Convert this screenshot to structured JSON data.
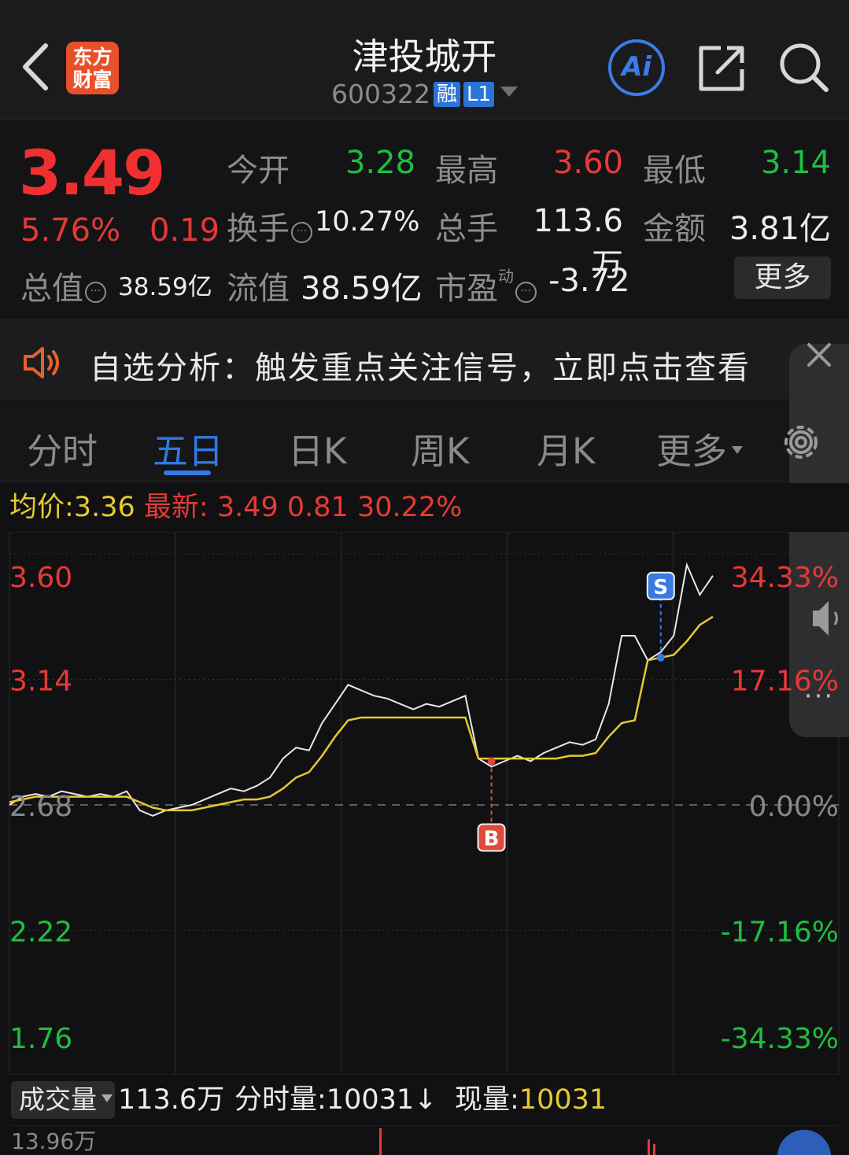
{
  "header": {
    "title": "津投城开",
    "code": "600322",
    "tag_margin": "融",
    "tag_level": "L1",
    "logo_line1": "东方",
    "logo_line2": "财富",
    "ai_label": "Ai"
  },
  "quote": {
    "price": "3.49",
    "change_pct": "5.76%",
    "change": "0.19",
    "open_label": "今开",
    "open": "3.28",
    "high_label": "最高",
    "high": "3.60",
    "low_label": "最低",
    "low": "3.14",
    "turnover_label": "换手",
    "turnover": "10.27%",
    "volume_label": "总手",
    "volume": "113.6万",
    "amount_label": "金额",
    "amount": "3.81亿",
    "mktcap_label": "总值",
    "mktcap": "38.59亿",
    "float_label": "流值",
    "float_cap": "38.59亿",
    "pe_label": "市盈",
    "pe_sup": "动",
    "pe": "-3.72",
    "more_label": "更多"
  },
  "banner": {
    "text": "自选分析：触发重点关注信号，立即点击查看"
  },
  "tabs": [
    {
      "label": "分时"
    },
    {
      "label": "五日"
    },
    {
      "label": "日K"
    },
    {
      "label": "周K"
    },
    {
      "label": "月K"
    },
    {
      "label": "更多"
    }
  ],
  "avg_row": {
    "avg_label": "均价:",
    "avg": "3.36",
    "latest_label": "最新:",
    "latest": "3.49",
    "change": "0.81",
    "change_pct": "30.22%"
  },
  "chart_data": {
    "type": "line",
    "y_labels_left": [
      "3.60",
      "3.14",
      "2.68",
      "2.22",
      "1.76"
    ],
    "y_labels_right": [
      "34.33%",
      "17.16%",
      "0.00%",
      "-17.16%",
      "-34.33%"
    ],
    "ylim": [
      1.76,
      3.6
    ],
    "baseline": 2.68,
    "days": 5,
    "series": [
      {
        "values": [
          2.68,
          2.71,
          2.72,
          2.71,
          2.73,
          2.72,
          2.71,
          2.72,
          2.71,
          2.73,
          2.66,
          2.64,
          2.66,
          2.67,
          2.68,
          2.7,
          2.72,
          2.74,
          2.73,
          2.75,
          2.78,
          2.85,
          2.89,
          2.88,
          2.98,
          3.05,
          3.12,
          3.1,
          3.08,
          3.07,
          3.05,
          3.03,
          3.05,
          3.04,
          3.06,
          3.08,
          2.85,
          2.82,
          2.84,
          2.86,
          2.84,
          2.87,
          2.89,
          2.91,
          2.9,
          2.92,
          3.05,
          3.3,
          3.3,
          3.21,
          3.24,
          3.3,
          3.56,
          3.45,
          3.52
        ]
      },
      {
        "values": [
          2.69,
          2.7,
          2.71,
          2.71,
          2.71,
          2.71,
          2.71,
          2.71,
          2.71,
          2.71,
          2.69,
          2.67,
          2.66,
          2.66,
          2.66,
          2.67,
          2.68,
          2.69,
          2.7,
          2.7,
          2.71,
          2.74,
          2.78,
          2.8,
          2.86,
          2.93,
          2.99,
          3.0,
          3.0,
          3.0,
          3.0,
          3.0,
          3.0,
          3.0,
          3.0,
          3.0,
          2.85,
          2.85,
          2.85,
          2.85,
          2.85,
          2.85,
          2.85,
          2.86,
          2.86,
          2.87,
          2.93,
          2.98,
          2.99,
          3.21,
          3.22,
          3.23,
          3.28,
          3.34,
          3.37
        ]
      }
    ],
    "markers": [
      {
        "label": "B",
        "value": 2.84
      },
      {
        "label": "S",
        "value": 3.22
      }
    ]
  },
  "volume": {
    "selector": "成交量",
    "total": "113.6万",
    "tick_label": "分时量:",
    "tick_value": "10031↓",
    "current_label": "现量:",
    "current_value": "10031",
    "axis_max": "13.96万"
  },
  "colors": {
    "up": "#e63a36",
    "down": "#1fbe3f",
    "accent": "#2e7ae6",
    "avg": "#e6c931"
  }
}
